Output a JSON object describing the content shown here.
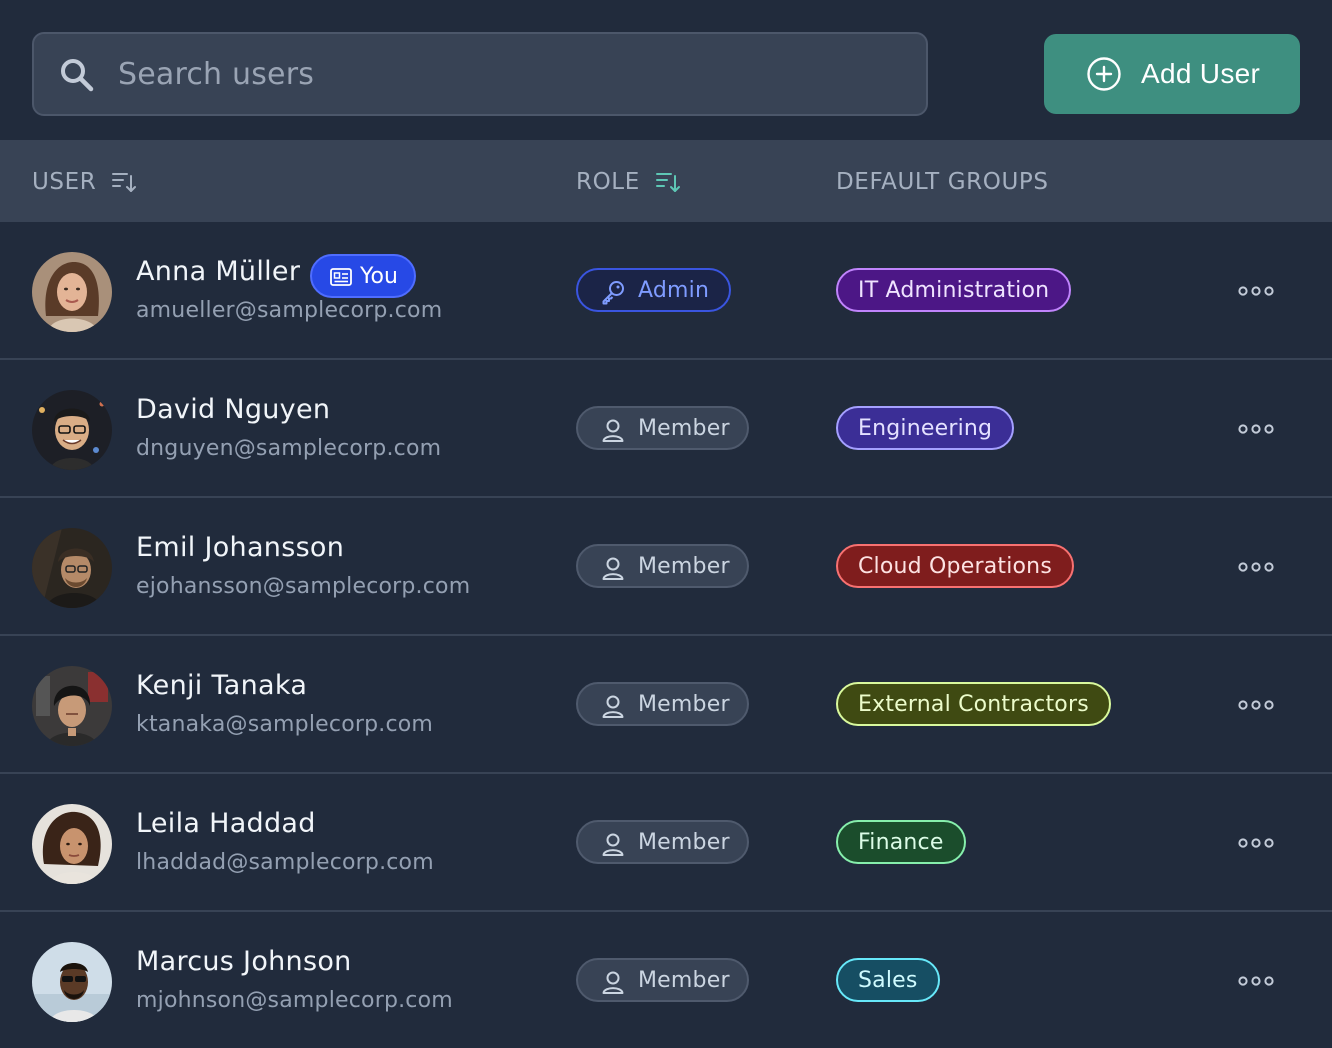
{
  "search": {
    "placeholder": "Search users",
    "value": ""
  },
  "add_user": {
    "label": "Add User"
  },
  "columns": {
    "user": "USER",
    "role": "ROLE",
    "groups": "DEFAULT GROUPS"
  },
  "badges": {
    "you": "You"
  },
  "colors": {
    "background": "#212b3c",
    "surface": "#384355",
    "accent": "#3e8f80",
    "you_badge": "#2749e6"
  },
  "users": [
    {
      "name": "Anna Müller",
      "email": "amueller@samplecorp.com",
      "is_you": true,
      "role": "Admin",
      "role_icon": "key-icon",
      "group": "IT Administration",
      "group_colors": {
        "bg": "#4c1786",
        "border": "#c084fc",
        "text": "#efe3ff"
      }
    },
    {
      "name": "David Nguyen",
      "email": "dnguyen@samplecorp.com",
      "is_you": false,
      "role": "Member",
      "role_icon": "user-icon",
      "group": "Engineering",
      "group_colors": {
        "bg": "#3b2e96",
        "border": "#a5a0ff",
        "text": "#e4e1ff"
      }
    },
    {
      "name": "Emil Johansson",
      "email": "ejohansson@samplecorp.com",
      "is_you": false,
      "role": "Member",
      "role_icon": "user-icon",
      "group": "Cloud Operations",
      "group_colors": {
        "bg": "#7f1d1d",
        "border": "#f87171",
        "text": "#fde2e2"
      }
    },
    {
      "name": "Kenji Tanaka",
      "email": "ktanaka@samplecorp.com",
      "is_you": false,
      "role": "Member",
      "role_icon": "user-icon",
      "group": "External Contractors",
      "group_colors": {
        "bg": "#3f4a12",
        "border": "#d9f99d",
        "text": "#ecfccb"
      }
    },
    {
      "name": "Leila Haddad",
      "email": "lhaddad@samplecorp.com",
      "is_you": false,
      "role": "Member",
      "role_icon": "user-icon",
      "group": "Finance",
      "group_colors": {
        "bg": "#1b4d2c",
        "border": "#86efac",
        "text": "#dcfce7"
      }
    },
    {
      "name": "Marcus Johnson",
      "email": "mjohnson@samplecorp.com",
      "is_you": false,
      "role": "Member",
      "role_icon": "user-icon",
      "group": "Sales",
      "group_colors": {
        "bg": "#164e63",
        "border": "#67e8f9",
        "text": "#cffafe"
      }
    }
  ]
}
